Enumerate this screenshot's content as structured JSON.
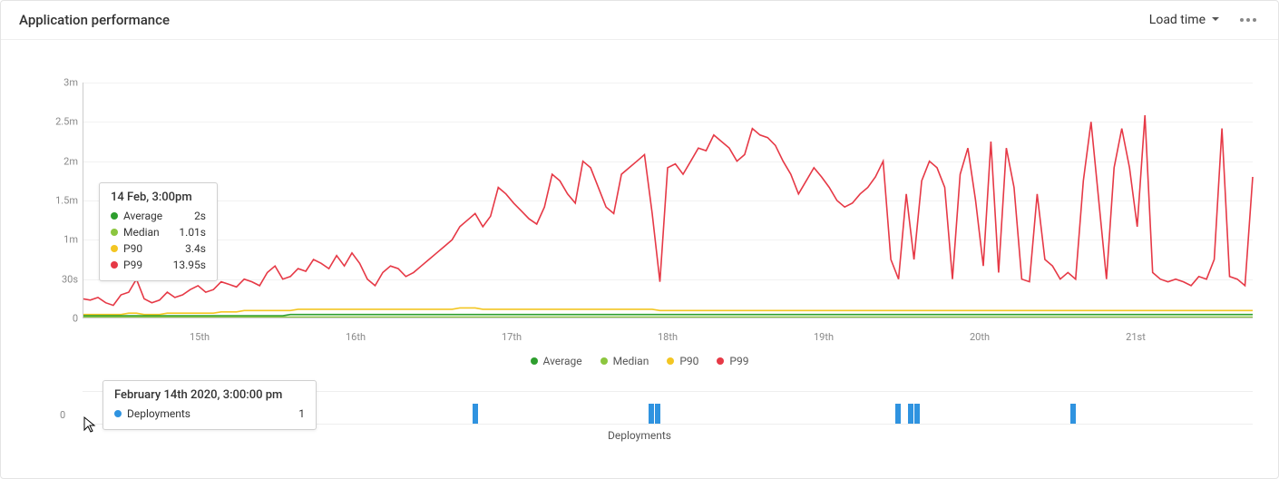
{
  "header": {
    "title": "Application performance",
    "dropdown_label": "Load time"
  },
  "tooltip_main": {
    "title": "14 Feb, 3:00pm",
    "rows": [
      {
        "label": "Average",
        "value": "2s",
        "color": "#2e9e2e"
      },
      {
        "label": "Median",
        "value": "1.01s",
        "color": "#8cc63f"
      },
      {
        "label": "P90",
        "value": "3.4s",
        "color": "#f3c623"
      },
      {
        "label": "P99",
        "value": "13.95s",
        "color": "#e63946"
      }
    ]
  },
  "tooltip_deploy": {
    "title": "February 14th 2020, 3:00:00 pm",
    "label": "Deployments",
    "value": "1",
    "color": "#2f93e0"
  },
  "legend": [
    {
      "label": "Average",
      "color": "#2e9e2e"
    },
    {
      "label": "Median",
      "color": "#8cc63f"
    },
    {
      "label": "P90",
      "color": "#f3c623"
    },
    {
      "label": "P99",
      "color": "#e63946"
    }
  ],
  "deploy_section_label": "Deployments",
  "deploy_y_tick": "0",
  "chart_data": {
    "type": "line",
    "title": "Application performance",
    "ylabel": "Load time",
    "y_ticks": [
      "0",
      "30s",
      "1m",
      "1.5m",
      "2m",
      "2.5m",
      "3m"
    ],
    "ylim_seconds": [
      0,
      180
    ],
    "x_ticks": [
      "15th",
      "16th",
      "17th",
      "18th",
      "19th",
      "20th",
      "21st"
    ],
    "x_range_hours": 180,
    "series": [
      {
        "name": "P99",
        "color": "#e63946",
        "values_seconds": [
          15,
          14,
          16,
          12,
          10,
          18,
          20,
          30,
          15,
          12,
          14,
          20,
          16,
          18,
          22,
          25,
          20,
          22,
          28,
          26,
          24,
          30,
          28,
          25,
          35,
          40,
          30,
          32,
          38,
          36,
          45,
          42,
          38,
          48,
          40,
          50,
          42,
          30,
          25,
          35,
          40,
          38,
          32,
          35,
          40,
          45,
          50,
          55,
          60,
          70,
          75,
          80,
          70,
          78,
          100,
          95,
          88,
          82,
          76,
          72,
          85,
          110,
          105,
          95,
          88,
          120,
          115,
          100,
          85,
          80,
          110,
          115,
          120,
          125,
          80,
          28,
          115,
          118,
          110,
          120,
          130,
          128,
          140,
          135,
          130,
          120,
          125,
          145,
          140,
          138,
          132,
          120,
          110,
          95,
          105,
          115,
          108,
          100,
          90,
          85,
          88,
          95,
          100,
          108,
          120,
          45,
          30,
          95,
          45,
          105,
          120,
          115,
          100,
          30,
          110,
          130,
          90,
          40,
          135,
          35,
          130,
          100,
          30,
          28,
          95,
          45,
          40,
          30,
          35,
          30,
          105,
          150,
          90,
          30,
          115,
          145,
          115,
          70,
          155,
          35,
          30,
          28,
          30,
          28,
          25,
          32,
          30,
          45,
          145,
          32,
          30,
          25,
          108
        ]
      },
      {
        "name": "P90",
        "color": "#f3c623",
        "values_seconds": [
          3,
          3,
          3,
          3,
          3,
          3,
          4,
          4,
          3,
          3,
          3,
          4,
          4,
          4,
          4,
          4,
          4,
          4,
          5,
          5,
          5,
          6,
          6,
          6,
          6,
          6,
          6,
          6,
          7,
          7,
          7,
          7,
          7,
          7,
          7,
          7,
          7,
          7,
          7,
          7,
          7,
          7,
          7,
          7,
          7,
          7,
          7,
          7,
          7,
          8,
          8,
          8,
          7,
          7,
          7,
          7,
          7,
          7,
          7,
          7,
          7,
          7,
          7,
          7,
          7,
          7,
          7,
          7,
          7,
          7,
          7,
          7,
          7,
          7,
          7,
          6,
          6,
          6,
          6,
          6,
          6,
          6,
          6,
          6,
          6,
          6,
          6,
          6,
          6,
          6,
          6,
          6,
          6,
          6,
          6,
          6,
          6,
          6,
          6,
          6,
          6,
          6,
          6,
          6,
          6,
          6,
          6,
          6,
          6,
          6,
          6,
          6,
          6,
          6,
          6,
          6,
          6,
          6,
          6,
          6,
          6,
          6,
          6,
          6,
          6,
          6,
          6,
          6,
          6,
          6,
          6,
          6,
          6,
          6,
          6,
          6,
          6,
          6,
          6,
          6,
          6,
          6,
          6,
          6,
          6,
          6,
          6,
          6,
          6,
          6,
          6,
          6,
          6
        ]
      },
      {
        "name": "Average",
        "color": "#2e9e2e",
        "values_seconds": [
          2,
          2,
          2,
          2,
          2,
          2,
          2,
          2,
          2,
          2,
          2,
          2,
          2,
          2,
          2,
          2,
          2,
          2,
          2,
          2,
          2,
          2,
          2,
          2,
          2,
          2,
          2,
          3,
          3,
          3,
          3,
          3,
          3,
          3,
          3,
          3,
          3,
          3,
          3,
          3,
          3,
          3,
          3,
          3,
          3,
          3,
          3,
          3,
          3,
          3,
          3,
          3,
          3,
          3,
          3,
          3,
          3,
          3,
          3,
          3,
          3,
          3,
          3,
          3,
          3,
          3,
          3,
          3,
          3,
          3,
          3,
          3,
          3,
          3,
          3,
          3,
          3,
          3,
          3,
          3,
          3,
          3,
          3,
          3,
          3,
          3,
          3,
          3,
          3,
          3,
          3,
          3,
          3,
          3,
          3,
          3,
          3,
          3,
          3,
          3,
          3,
          3,
          3,
          3,
          3,
          3,
          3,
          3,
          3,
          3,
          3,
          3,
          3,
          3,
          3,
          3,
          3,
          3,
          3,
          3,
          3,
          3,
          3,
          3,
          3,
          3,
          3,
          3,
          3,
          3,
          3,
          3,
          3,
          3,
          3,
          3,
          3,
          3,
          3,
          3,
          3,
          3,
          3,
          3,
          3,
          3,
          3,
          3,
          3,
          3,
          3,
          3,
          3
        ]
      },
      {
        "name": "Median",
        "color": "#8cc63f",
        "values_seconds": [
          1,
          1,
          1,
          1,
          1,
          1,
          1,
          1,
          1,
          1,
          1,
          1,
          1,
          1,
          1,
          1,
          1,
          1,
          1,
          1,
          1,
          1,
          1,
          1,
          1,
          1,
          1,
          1,
          1,
          1,
          1,
          1,
          1,
          1,
          1,
          1,
          1,
          1,
          1,
          1,
          1,
          1,
          1,
          1,
          1,
          1,
          1,
          1,
          1,
          1,
          1,
          1,
          1,
          1,
          1,
          1,
          1,
          1,
          1,
          1,
          1,
          1,
          1,
          1,
          1,
          1,
          1,
          1,
          1,
          1,
          1,
          1,
          1,
          1,
          1,
          1,
          1,
          1,
          1,
          1,
          1,
          1,
          1,
          1,
          1,
          1,
          1,
          1,
          1,
          1,
          1,
          1,
          1,
          1,
          1,
          1,
          1,
          1,
          1,
          1,
          1,
          1,
          1,
          1,
          1,
          1,
          1,
          1,
          1,
          1,
          1,
          1,
          1,
          1,
          1,
          1,
          1,
          1,
          1,
          1,
          1,
          1,
          1,
          1,
          1,
          1,
          1,
          1,
          1,
          1,
          1,
          1,
          1,
          1,
          1,
          1,
          1,
          1,
          1,
          1,
          1,
          1,
          1,
          1,
          1,
          1,
          1,
          1,
          1,
          1,
          1,
          1,
          1
        ]
      }
    ],
    "deployments": {
      "type": "bar",
      "label": "Deployments",
      "positions_hours": [
        3,
        60,
        87,
        88,
        125,
        127,
        128,
        152
      ],
      "values": [
        1,
        1,
        1,
        1,
        1,
        1,
        1,
        1
      ]
    }
  }
}
